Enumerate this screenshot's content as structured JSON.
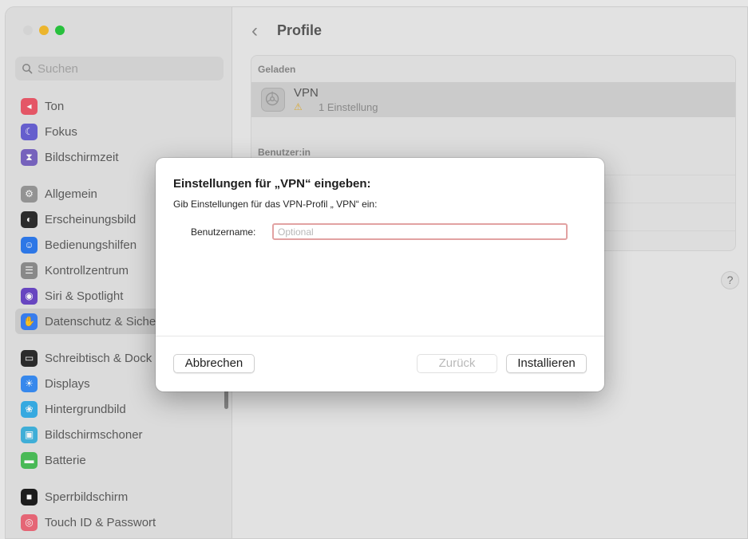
{
  "window": {
    "traffic_lights": [
      "#dcdcdc",
      "#f6bd2f",
      "#2ac840"
    ]
  },
  "sidebar": {
    "search_placeholder": "Suchen",
    "groups": [
      [
        {
          "label": "Ton",
          "icon": "speaker-icon",
          "color": "#ee5a6b"
        },
        {
          "label": "Fokus",
          "icon": "moon-icon",
          "color": "#6a62d6"
        },
        {
          "label": "Bildschirmzeit",
          "icon": "hourglass-icon",
          "color": "#7b66c4"
        }
      ],
      [
        {
          "label": "Allgemein",
          "icon": "gear-icon",
          "color": "#9a9a9a"
        },
        {
          "label": "Erscheinungsbild",
          "icon": "appearance-icon",
          "color": "#2e2e2e"
        },
        {
          "label": "Bedienungshilfen",
          "icon": "accessibility-icon",
          "color": "#2f7cf0"
        },
        {
          "label": "Kontrollzentrum",
          "icon": "control-center-icon",
          "color": "#8f8f8f"
        },
        {
          "label": "Siri & Spotlight",
          "icon": "siri-icon",
          "color": "#6c48c8"
        },
        {
          "label": "Datenschutz & Sicherheit",
          "icon": "hand-icon",
          "color": "#3b82f6",
          "active": true
        }
      ],
      [
        {
          "label": "Schreibtisch & Dock",
          "icon": "dock-icon",
          "color": "#2d2d2d"
        },
        {
          "label": "Displays",
          "icon": "sun-icon",
          "color": "#3a8ef6"
        },
        {
          "label": "Hintergrundbild",
          "icon": "flower-icon",
          "color": "#39b0ea"
        },
        {
          "label": "Bildschirmschoner",
          "icon": "screensaver-icon",
          "color": "#42b6e0"
        },
        {
          "label": "Batterie",
          "icon": "battery-icon",
          "color": "#4cc15a"
        }
      ],
      [
        {
          "label": "Sperrbildschirm",
          "icon": "lock-icon",
          "color": "#1f1f1f"
        },
        {
          "label": "Touch ID & Passwort",
          "icon": "fingerprint-icon",
          "color": "#ef6a7a"
        }
      ]
    ]
  },
  "main": {
    "title": "Profile",
    "loaded_label": "Geladen",
    "vpn_name": "VPN",
    "vpn_warning_glyph": "⚠",
    "vpn_settings_count": "1 Einstellung",
    "user_label": "Benutzer:in",
    "help_label": "?"
  },
  "dialog": {
    "title": "Einstellungen für „VPN“ eingeben:",
    "subtitle": "Gib Einstellungen für das VPN-Profil „ VPN“ ein:",
    "username_label": "Benutzername:",
    "username_value": "",
    "username_placeholder": "Optional",
    "cancel_label": "Abbrechen",
    "back_label": "Zurück",
    "install_label": "Installieren"
  }
}
